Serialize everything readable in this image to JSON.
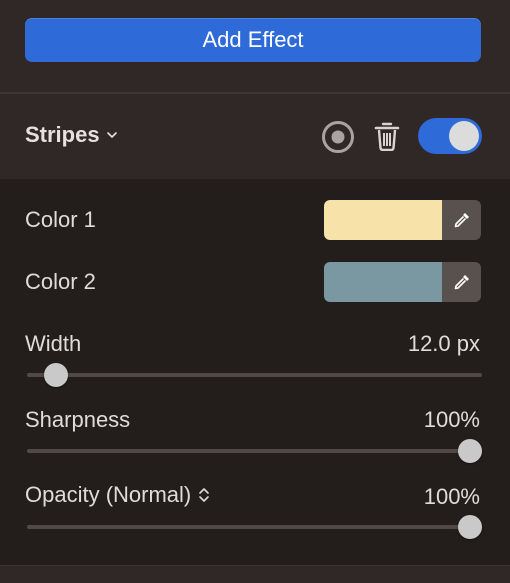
{
  "add_effect_label": "Add Effect",
  "effect": {
    "name": "Stripes",
    "enabled": true
  },
  "colors": [
    {
      "label": "Color 1",
      "value": "#f7e2aa"
    },
    {
      "label": "Color 2",
      "value": "#7a98a2"
    }
  ],
  "sliders": [
    {
      "label": "Width",
      "value_text": "12.0 px",
      "fraction": 0.04
    },
    {
      "label": "Sharpness",
      "value_text": "100%",
      "fraction": 1.0
    },
    {
      "label": "Opacity (Normal)",
      "value_text": "100%",
      "fraction": 1.0
    }
  ],
  "theme": {
    "accent": "#2f6bd8",
    "panel": "#2f2826",
    "body": "#231d1b"
  },
  "icons": {
    "chevron": "chevron-down-icon",
    "target": "target-icon",
    "trash": "trash-icon",
    "eyedropper": "eyedropper-icon",
    "updown": "up-down-chevron-icon"
  }
}
